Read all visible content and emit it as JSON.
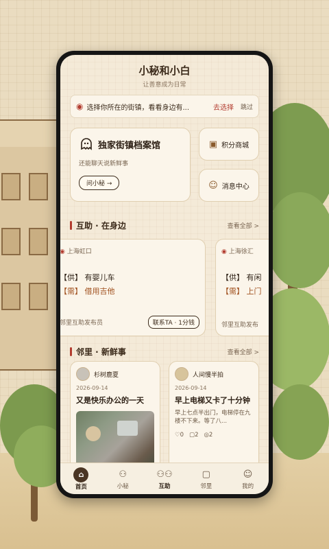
{
  "app": {
    "title": "小秘和小白",
    "subtitle": "让善意成为日常"
  },
  "location_bar": {
    "pin_icon": "map-pin-icon",
    "text": "选择你所在的街镇，看看身边有...",
    "choose_label": "去选择",
    "skip_label": "跳过"
  },
  "archive": {
    "title": "独家街镇档案馆",
    "desc": "还能聊天说新鲜事",
    "button": "问小秘 →"
  },
  "side_buttons": [
    {
      "label": "积分商城",
      "icon": "gift-icon"
    },
    {
      "label": "消息中心",
      "icon": "face-icon"
    }
  ],
  "section_help": {
    "title": "互助 · 在身边",
    "more": "查看全部 >"
  },
  "help_cards": [
    {
      "location": "上海虹口",
      "supply": "【供】 有婴儿车",
      "need": "【需】 借用吉他",
      "publisher": "邻里互助发布员",
      "contact": "联系TA · 1分钱"
    },
    {
      "location": "上海徐汇",
      "supply": "【供】 有闲",
      "need": "【需】 上门",
      "publisher": "邻里互助发布"
    }
  ],
  "section_news": {
    "title": "邻里 · 新鲜事",
    "more": "查看全部 >"
  },
  "posts": [
    {
      "author": "杉树鹿夏",
      "date": "2026-09-14",
      "title": "又是快乐办公的一天"
    },
    {
      "author": "人间慢半拍",
      "date": "2026-09-14",
      "title": "早上电梯又卡了十分钟",
      "body": "早上七点半出门，电梯停在九楼不下来。等了八...",
      "likes": "0",
      "comments": "2",
      "views": "2"
    }
  ],
  "tabs": [
    {
      "label": "首页",
      "icon": "home-icon",
      "active": true
    },
    {
      "label": "小秘",
      "icon": "ghost-icon"
    },
    {
      "label": "互助",
      "icon": "group-icon"
    },
    {
      "label": "邻里",
      "icon": "chat-icon"
    },
    {
      "label": "我的",
      "icon": "user-icon"
    }
  ],
  "colors": {
    "accent": "#b23b2e",
    "dark": "#4a3524",
    "paper": "#f4ead8"
  }
}
